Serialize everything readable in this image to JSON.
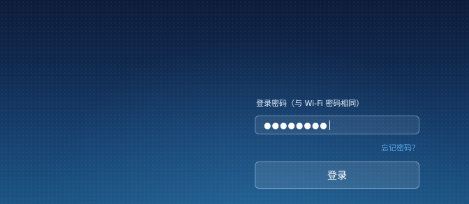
{
  "login": {
    "password_label": "登录密码（与 Wi-Fi 密码相同）",
    "password_masked": "●●●●●●●●",
    "forgot_link": "忘记密码？",
    "submit_label": "登录"
  },
  "colors": {
    "background_top": "#0d1c3b",
    "background_bottom": "#1c5584",
    "link": "#58a8e8",
    "text": "#ffffff"
  }
}
